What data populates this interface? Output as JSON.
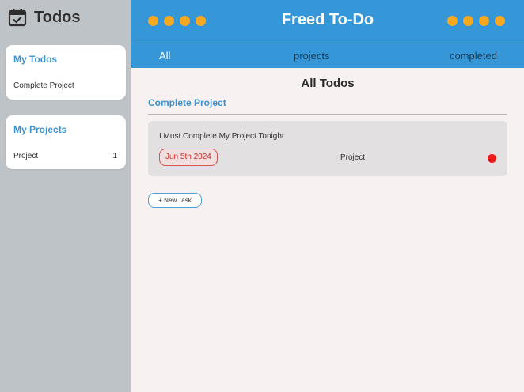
{
  "sidebar": {
    "brand_icon": "calendar-check-icon",
    "brand_title": "Todos",
    "my_todos": {
      "title": "My Todos",
      "items": [
        {
          "label": "Complete Project"
        }
      ]
    },
    "my_projects": {
      "title": "My Projects",
      "items": [
        {
          "label": "Project",
          "count": "1"
        }
      ]
    }
  },
  "header": {
    "title": "Freed To-Do",
    "dot_color": "#f7a823",
    "background": "#3596d8"
  },
  "tabs": [
    {
      "label": "All",
      "active": true
    },
    {
      "label": "projects",
      "active": false
    },
    {
      "label": "completed",
      "active": false
    }
  ],
  "main": {
    "page_title": "All Todos",
    "section_title": "Complete Project",
    "todos": [
      {
        "text": "I Must Complete My Project Tonight",
        "due": "Jun 5th 2024",
        "project": "Project",
        "priority_color": "#ea1c1c"
      }
    ],
    "new_task_label": "+ New Task"
  }
}
